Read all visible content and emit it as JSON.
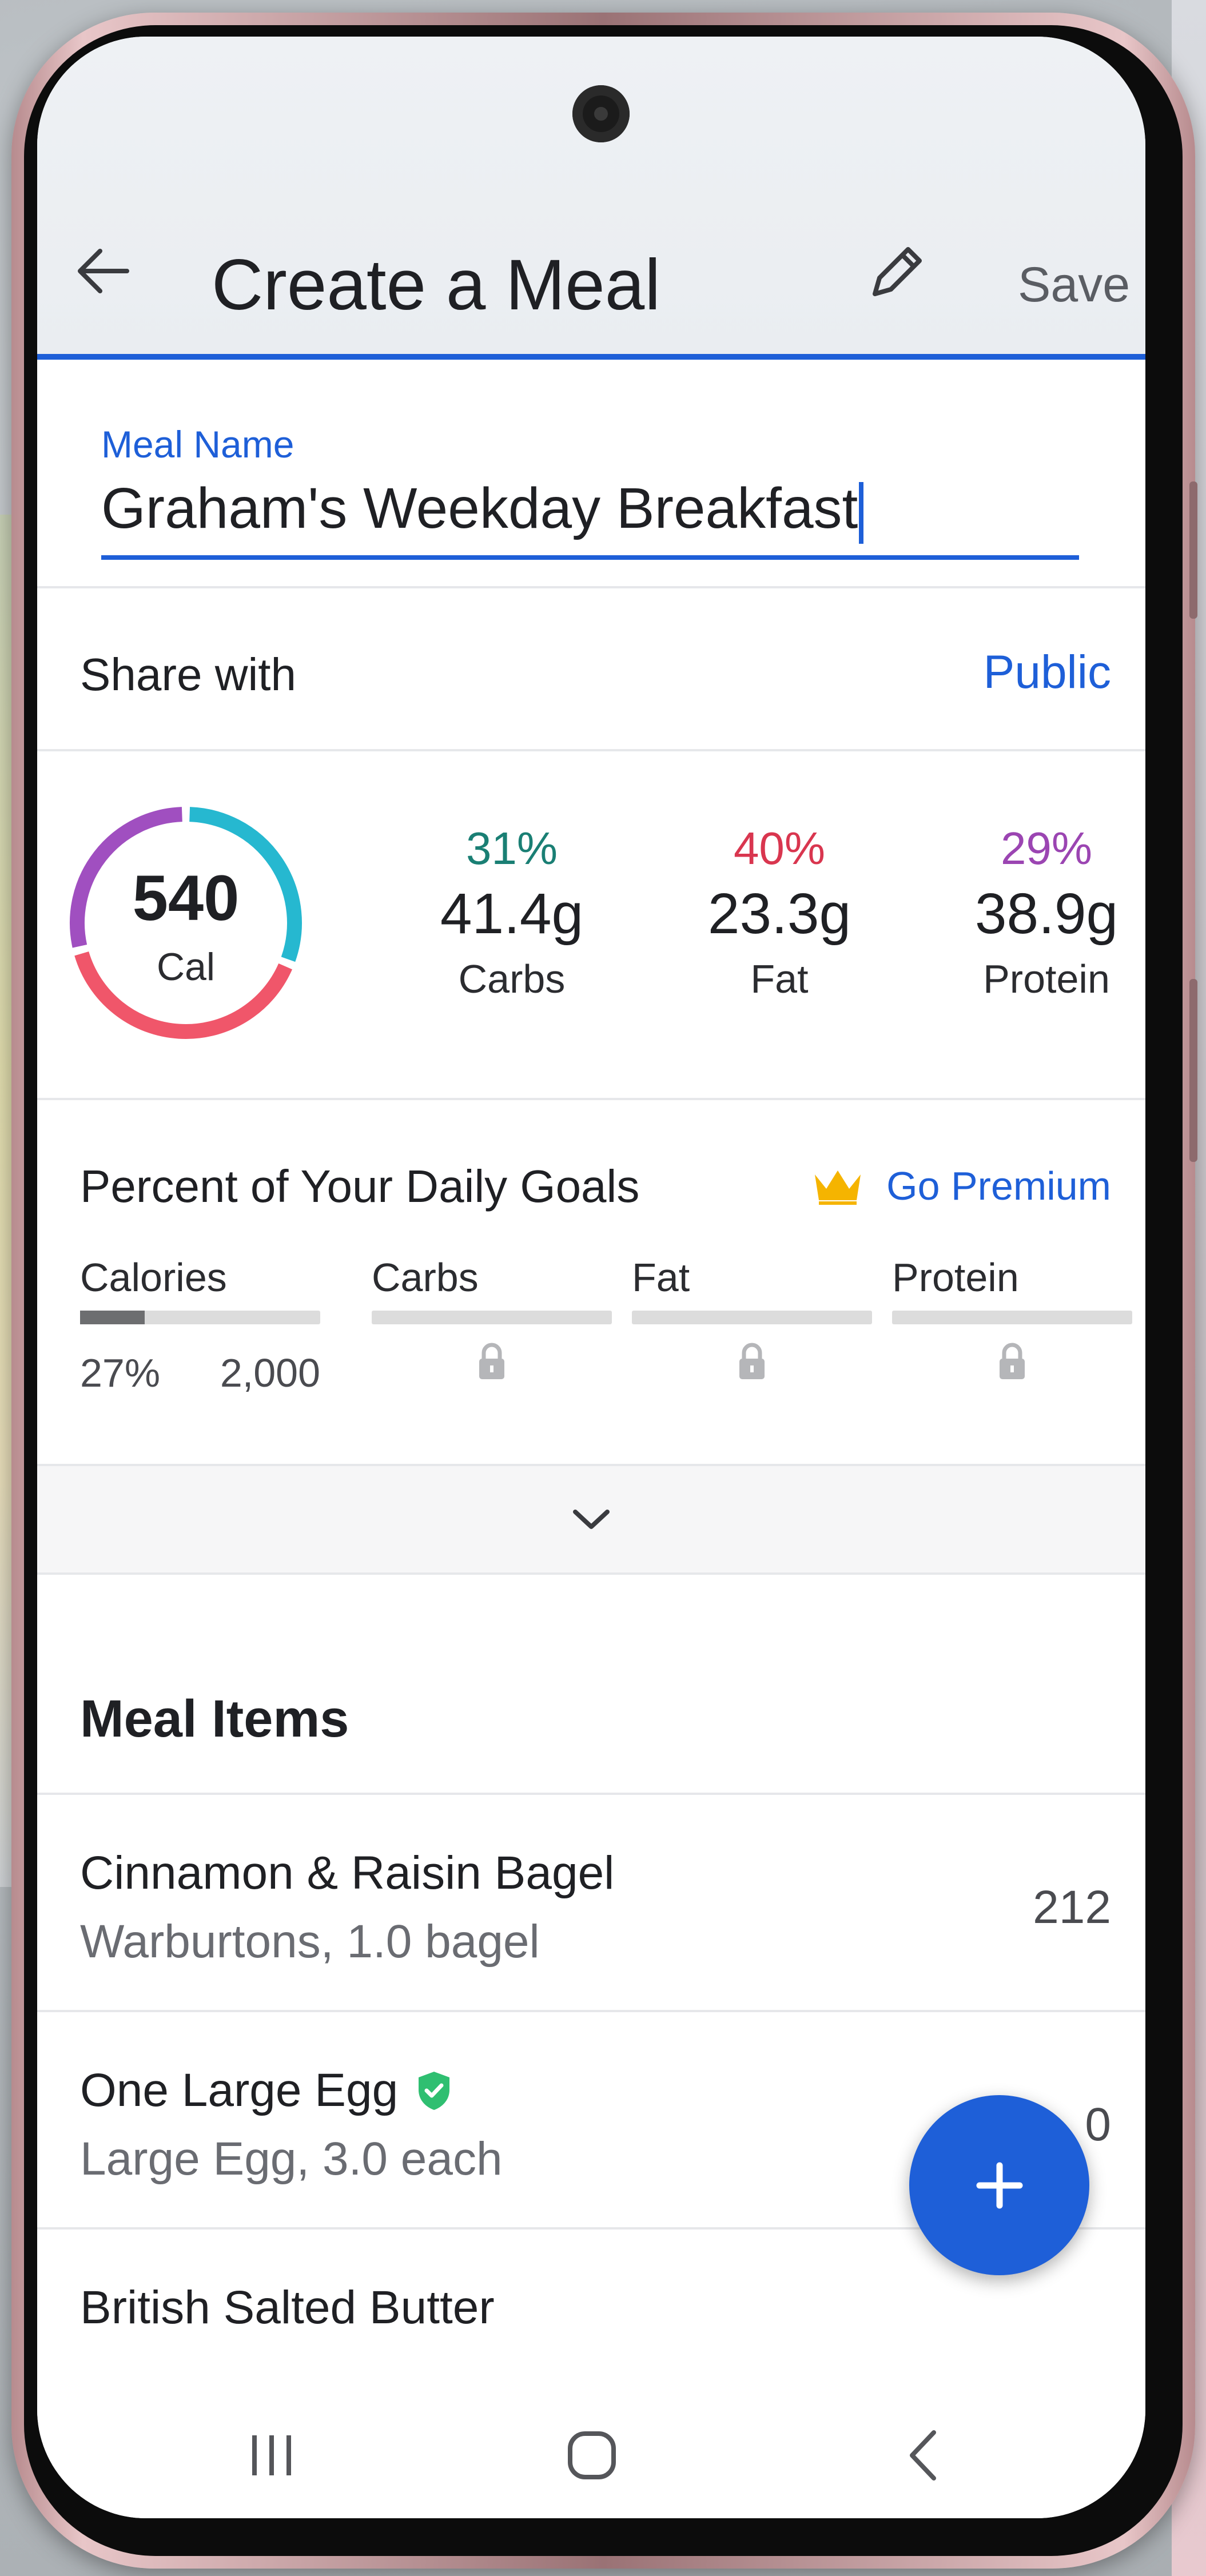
{
  "app_bar": {
    "title": "Create a Meal",
    "save_label": "Save",
    "back_icon": "arrow-left-icon",
    "edit_icon": "pencil-icon"
  },
  "meal_name": {
    "label": "Meal Name",
    "value": "Graham's Weekday Breakfast"
  },
  "share": {
    "label": "Share with",
    "value": "Public"
  },
  "nutrition": {
    "calories": "540",
    "calories_unit": "Cal",
    "macros": [
      {
        "percent": "31%",
        "grams": "41.4g",
        "name": "Carbs",
        "color": "#1a7f74"
      },
      {
        "percent": "40%",
        "grams": "23.3g",
        "name": "Fat",
        "color": "#d9364f"
      },
      {
        "percent": "29%",
        "grams": "38.9g",
        "name": "Protein",
        "color": "#9b45b2"
      }
    ],
    "ring_colors": {
      "carbs": "#26b8d0",
      "fat": "#f0566a",
      "protein": "#a04fc0"
    }
  },
  "daily_goals": {
    "title": "Percent of Your Daily Goals",
    "premium_label": "Go Premium",
    "premium_icon": "crown-icon",
    "columns": [
      {
        "label": "Calories",
        "percent_text": "27%",
        "goal_text": "2,000",
        "fill": 0.27
      },
      {
        "label": "Carbs",
        "locked": true
      },
      {
        "label": "Fat",
        "locked": true
      },
      {
        "label": "Protein",
        "locked": true
      }
    ]
  },
  "meal_items": {
    "title": "Meal Items",
    "items": [
      {
        "name": "Cinnamon & Raisin Bagel",
        "detail": "Warburtons, 1.0 bagel",
        "calories": "212",
        "verified": false
      },
      {
        "name": "One Large Egg",
        "detail": "Large  Egg, 3.0 each",
        "calories": "0",
        "verified": true
      },
      {
        "name": "British Salted Butter",
        "detail": "",
        "calories": "",
        "verified": false
      }
    ]
  },
  "colors": {
    "accent": "#1e5fd8",
    "verified": "#2fbf71",
    "premium": "#f5b400"
  }
}
